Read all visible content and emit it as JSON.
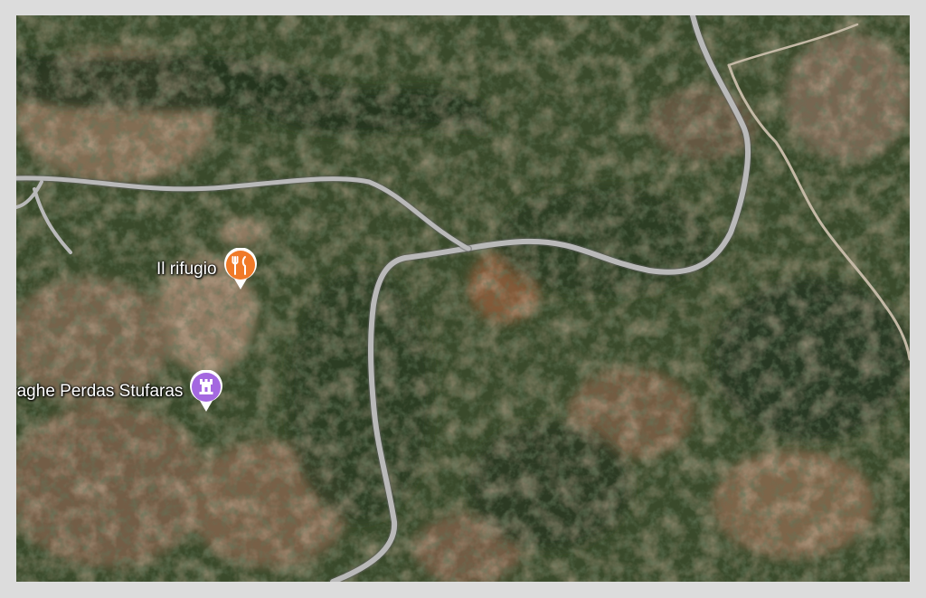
{
  "map": {
    "view": "satellite",
    "road_color": "#b9b9b9",
    "places": [
      {
        "name": "Il rifugio",
        "category": "restaurant",
        "icon": "fork-knife-icon",
        "color": "#f07a28"
      },
      {
        "name": "Nuraghe Perdas Stufaras",
        "category": "historic-site",
        "icon": "castle-icon",
        "color": "#a468e0"
      }
    ]
  }
}
